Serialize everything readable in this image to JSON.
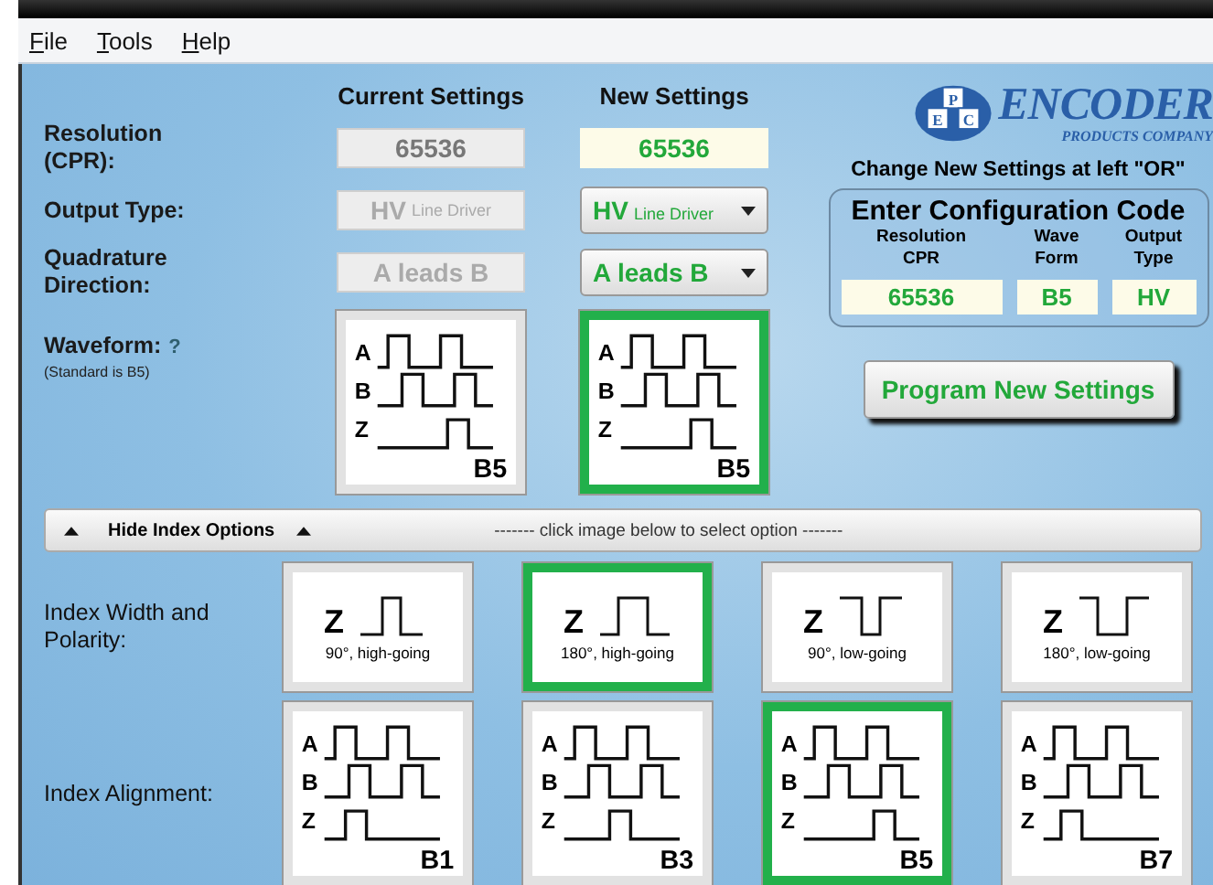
{
  "menu": [
    {
      "label": "File"
    },
    {
      "label": "Tools"
    },
    {
      "label": "Help"
    }
  ],
  "columns": {
    "current": "Current Settings",
    "new": "New Settings"
  },
  "rows": [
    {
      "label": "Resolution (CPR):",
      "kind": "text",
      "current": "65536",
      "new": "65536"
    },
    {
      "label": "Output Type:",
      "kind": "dropdown",
      "current": {
        "code": "HV",
        "description": "Line Driver"
      },
      "new": {
        "code": "HV",
        "description": "Line Driver"
      }
    },
    {
      "label": "Quadrature Direction:",
      "kind": "dropdown",
      "current": {
        "code": "A leads B"
      },
      "new": {
        "code": "A leads B"
      }
    }
  ],
  "waveform": {
    "label": "Waveform:",
    "help": "?",
    "note": "(Standard is B5)",
    "current": {
      "kind": "b5",
      "signals": [
        "A",
        "B",
        "Z"
      ],
      "code": "B5",
      "selected": false
    },
    "new": {
      "kind": "b5",
      "signals": [
        "A",
        "B",
        "Z"
      ],
      "code": "B5",
      "selected": true
    }
  },
  "logo": {
    "initials": [
      "P",
      "E",
      "C"
    ],
    "name": "ENCODER",
    "subtitle": "PRODUCTS COMPANY"
  },
  "config": {
    "intro": "Change New Settings at left \"OR\"",
    "title": "Enter Configuration Code",
    "fields": [
      {
        "label": "Resolution CPR",
        "value": "65536"
      },
      {
        "label": "Wave Form",
        "value": "B5"
      },
      {
        "label": "Output Type",
        "value": "HV"
      }
    ]
  },
  "program_button": "Program New Settings",
  "index_bar": {
    "label": "Hide Index Options",
    "expanded": true,
    "hint": "------- click image below to select option -------"
  },
  "index_width": {
    "label": "Index Width and Polarity:",
    "options": [
      {
        "kind": "high-90",
        "signal": "Z",
        "caption": "90°, high-going",
        "selected": false
      },
      {
        "kind": "high-180",
        "signal": "Z",
        "caption": "180°, high-going",
        "selected": true
      },
      {
        "kind": "low-90",
        "signal": "Z",
        "caption": "90°, low-going",
        "selected": false
      },
      {
        "kind": "low-180",
        "signal": "Z",
        "caption": "180°, low-going",
        "selected": false
      }
    ]
  },
  "index_alignment": {
    "label": "Index Alignment:",
    "options": [
      {
        "kind": "b1",
        "signals": [
          "A",
          "B",
          "Z"
        ],
        "code": "B1",
        "selected": false
      },
      {
        "kind": "b3",
        "signals": [
          "A",
          "B",
          "Z"
        ],
        "code": "B3",
        "selected": false
      },
      {
        "kind": "b5",
        "signals": [
          "A",
          "B",
          "Z"
        ],
        "code": "B5",
        "selected": true
      },
      {
        "kind": "b7",
        "signals": [
          "A",
          "B",
          "Z"
        ],
        "code": "B7",
        "selected": false
      }
    ]
  }
}
